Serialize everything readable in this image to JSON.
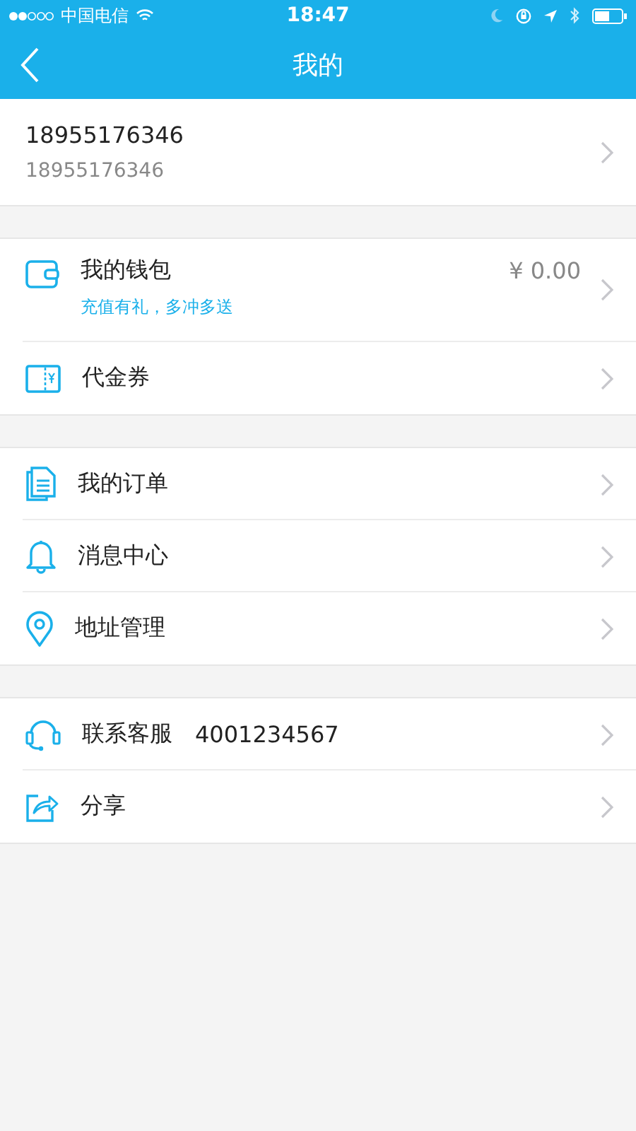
{
  "status_bar": {
    "carrier": "中国电信",
    "time": "18:47"
  },
  "nav": {
    "title": "我的"
  },
  "profile": {
    "name": "18955176346",
    "phone": "18955176346"
  },
  "sections": [
    {
      "items": [
        {
          "kind": "wallet",
          "label": "我的钱包",
          "subtitle": "充值有礼，多冲多送",
          "value": "¥ 0.00"
        },
        {
          "kind": "coupon",
          "label": "代金券"
        }
      ]
    },
    {
      "items": [
        {
          "kind": "orders",
          "label": "我的订单"
        },
        {
          "kind": "bell",
          "label": "消息中心"
        },
        {
          "kind": "pin",
          "label": "地址管理"
        }
      ]
    },
    {
      "items": [
        {
          "kind": "headset",
          "label": "联系客服",
          "extra": "4001234567"
        },
        {
          "kind": "share",
          "label": "分享"
        }
      ]
    }
  ]
}
